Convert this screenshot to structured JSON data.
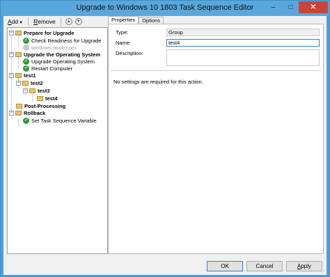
{
  "window": {
    "title": "Upgrade to Windows 10 1803 Task Sequence Editor",
    "minimize": "–",
    "maximize": "□",
    "close": "✕"
  },
  "toolbar": {
    "add_prefix": "A",
    "add_rest": "dd",
    "remove_prefix": "R",
    "remove_rest": "emove"
  },
  "tree": {
    "items": [
      {
        "label": "Prepare for Upgrade",
        "type": "group"
      },
      {
        "label": "Check Readiness for Upgrade",
        "type": "step"
      },
      {
        "label": "windows-noob.com",
        "type": "step-disabled"
      },
      {
        "label": "Upgrade the Operating System",
        "type": "group"
      },
      {
        "label": "Upgrade Operating System",
        "type": "step"
      },
      {
        "label": "Restart Computer",
        "type": "step"
      },
      {
        "label": "test1",
        "type": "group"
      },
      {
        "label": "test2",
        "type": "group"
      },
      {
        "label": "test3",
        "type": "group"
      },
      {
        "label": "test4",
        "type": "group"
      },
      {
        "label": "Post-Processing",
        "type": "group"
      },
      {
        "label": "Rollback",
        "type": "group"
      },
      {
        "label": "Set Task Sequence Variable",
        "type": "step"
      }
    ]
  },
  "tabs": [
    "Properties",
    "Options"
  ],
  "properties": {
    "type_label": "Type:",
    "type_value": "Group",
    "name_label": "Name:",
    "name_value": "test4",
    "description_label": "Description:",
    "description_value": "",
    "message": "No settings are required for this action."
  },
  "buttons": {
    "ok": "OK",
    "cancel": "Cancel",
    "apply_prefix": "A",
    "apply_rest": "pply"
  },
  "colors": {
    "titlebar": "#5aa7dc",
    "close": "#c7463b",
    "check": "#2e9c34",
    "folder": "#e8c46a"
  }
}
